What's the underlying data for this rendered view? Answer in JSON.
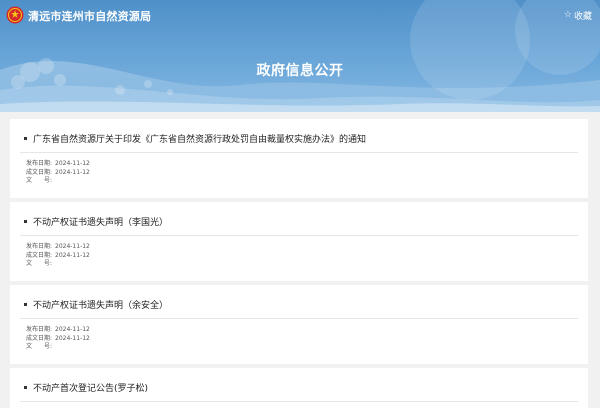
{
  "header": {
    "site_name": "清远市连州市自然资源局",
    "favorite_label": "收藏",
    "page_title": "政府信息公开"
  },
  "meta_labels": {
    "publish": "发布日期:",
    "created": "成文日期:",
    "doc_no": "文　　号:"
  },
  "items": [
    {
      "title": "广东省自然资源厅关于印发《广东省自然资源行政处罚自由裁量权实施办法》的通知",
      "publish_date": "2024-11-12",
      "created_date": "2024-11-12",
      "doc_no": ""
    },
    {
      "title": "不动产权证书遗失声明（李国光）",
      "publish_date": "2024-11-12",
      "created_date": "2024-11-12",
      "doc_no": ""
    },
    {
      "title": "不动产权证书遗失声明（余安全）",
      "publish_date": "2024-11-12",
      "created_date": "2024-11-12",
      "doc_no": ""
    },
    {
      "title": "不动产首次登记公告(罗子松)",
      "publish_date": "",
      "created_date": "",
      "doc_no": ""
    }
  ]
}
